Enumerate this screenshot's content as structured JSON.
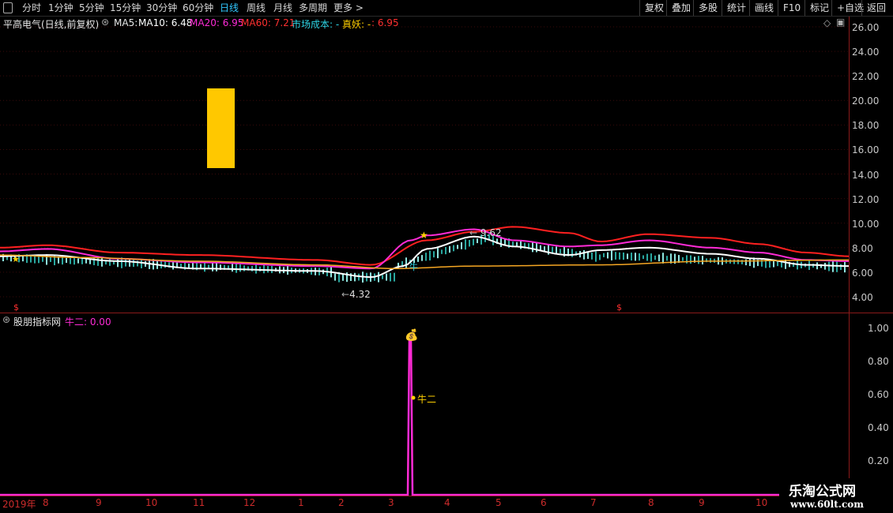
{
  "toolbar": {
    "tabs": [
      {
        "label": "分时"
      },
      {
        "label": "1分钟"
      },
      {
        "label": "5分钟"
      },
      {
        "label": "15分钟"
      },
      {
        "label": "30分钟"
      },
      {
        "label": "60分钟"
      },
      {
        "label": "日线"
      },
      {
        "label": "周线"
      },
      {
        "label": "月线"
      },
      {
        "label": "多周期"
      },
      {
        "label": "更多 >"
      }
    ],
    "right_buttons": [
      {
        "label": "复权"
      },
      {
        "label": "叠加"
      },
      {
        "label": "多股"
      },
      {
        "label": "统计"
      },
      {
        "label": "画线"
      },
      {
        "label": "F10"
      },
      {
        "label": "标记"
      },
      {
        "label": "+自选"
      },
      {
        "label": "返回"
      }
    ]
  },
  "main_panel": {
    "title": "平高电气(日线,前复权)",
    "indicators": {
      "ma5": "MA5:",
      "ma10": "MA10: 6.48",
      "ma20": "MA20: 6.95",
      "ma60": "MA60: 7.21",
      "cost": "市场成本: -",
      "zhenyao": "真妖: -",
      "zhenyao_val": ": 6.95"
    },
    "high_label": "9.62",
    "low_label": "4.32",
    "y_axis": [
      "26.00",
      "24.00",
      "22.00",
      "20.00",
      "18.00",
      "16.00",
      "14.00",
      "12.00",
      "10.00",
      "8.00",
      "6.00",
      "4.00"
    ],
    "colors": {
      "ma10": "#ffffff",
      "ma20": "#ff2bd6",
      "ma60": "#ff2020",
      "cost": "#f5a623",
      "accent_block": "#ffc800"
    }
  },
  "sub_panel": {
    "title": "股朋指标网",
    "indicator": "牛二: 0.00",
    "point_label": "牛二",
    "y_axis": [
      "1.00",
      "0.80",
      "0.60",
      "0.40",
      "0.20"
    ]
  },
  "x_axis": {
    "labels": [
      {
        "t": "2019年"
      },
      {
        "t": "8"
      },
      {
        "t": "9"
      },
      {
        "t": "10"
      },
      {
        "t": "11"
      },
      {
        "t": "12"
      },
      {
        "t": "1"
      },
      {
        "t": "2"
      },
      {
        "t": "3"
      },
      {
        "t": "4"
      },
      {
        "t": "5"
      },
      {
        "t": "6"
      },
      {
        "t": "7"
      },
      {
        "t": "8"
      },
      {
        "t": "9"
      },
      {
        "t": "10"
      }
    ]
  },
  "watermark": {
    "line1": "乐淘公式网",
    "line2": "www.60lt.com"
  }
}
